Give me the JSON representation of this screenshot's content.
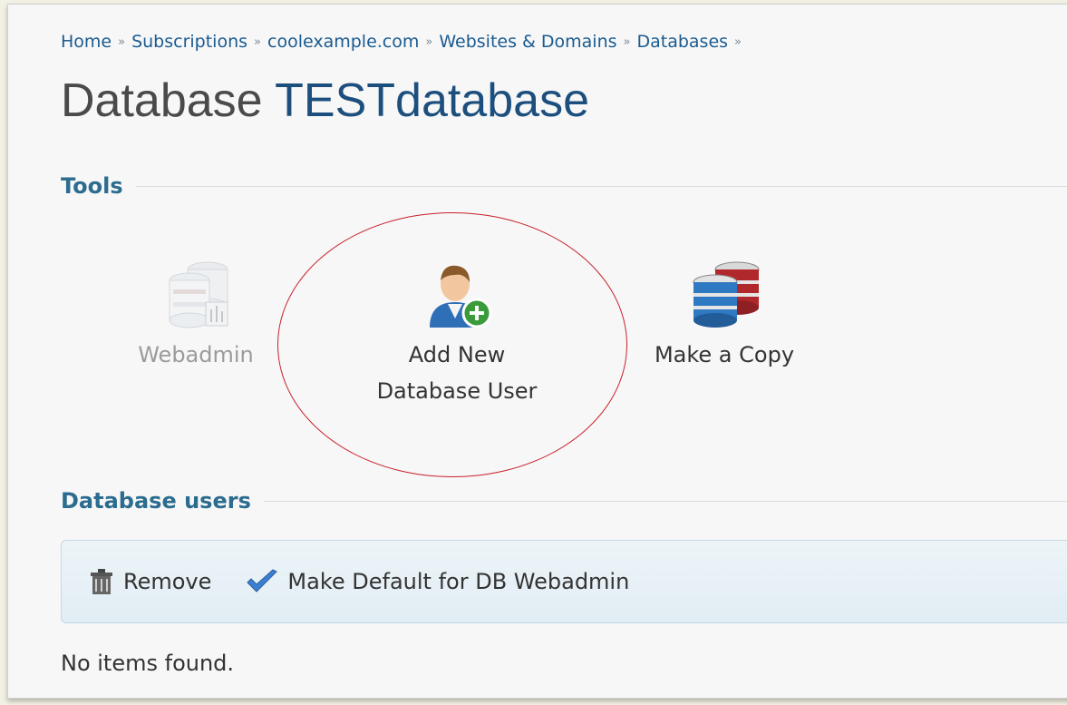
{
  "breadcrumb": {
    "items": [
      "Home",
      "Subscriptions",
      "coolexample.com",
      "Websites & Domains",
      "Databases"
    ],
    "separator": "»"
  },
  "page": {
    "title_prefix": "Database",
    "title_name": "TESTdatabase"
  },
  "tools": {
    "heading": "Tools",
    "items": [
      {
        "label": "Webadmin",
        "icon": "webadmin-icon",
        "enabled": false
      },
      {
        "label_line1": "Add New",
        "label_line2": "Database User",
        "icon": "add-user-icon",
        "enabled": true
      },
      {
        "label": "Make a Copy",
        "icon": "copy-database-icon",
        "enabled": true
      }
    ]
  },
  "database_users": {
    "heading": "Database users",
    "toolbar": {
      "remove_label": "Remove",
      "make_default_label": "Make Default for DB Webadmin"
    },
    "empty_message": "No items found."
  },
  "colors": {
    "link": "#1a5b92",
    "section_heading": "#2b6c8f",
    "highlight": "#c8212a"
  }
}
